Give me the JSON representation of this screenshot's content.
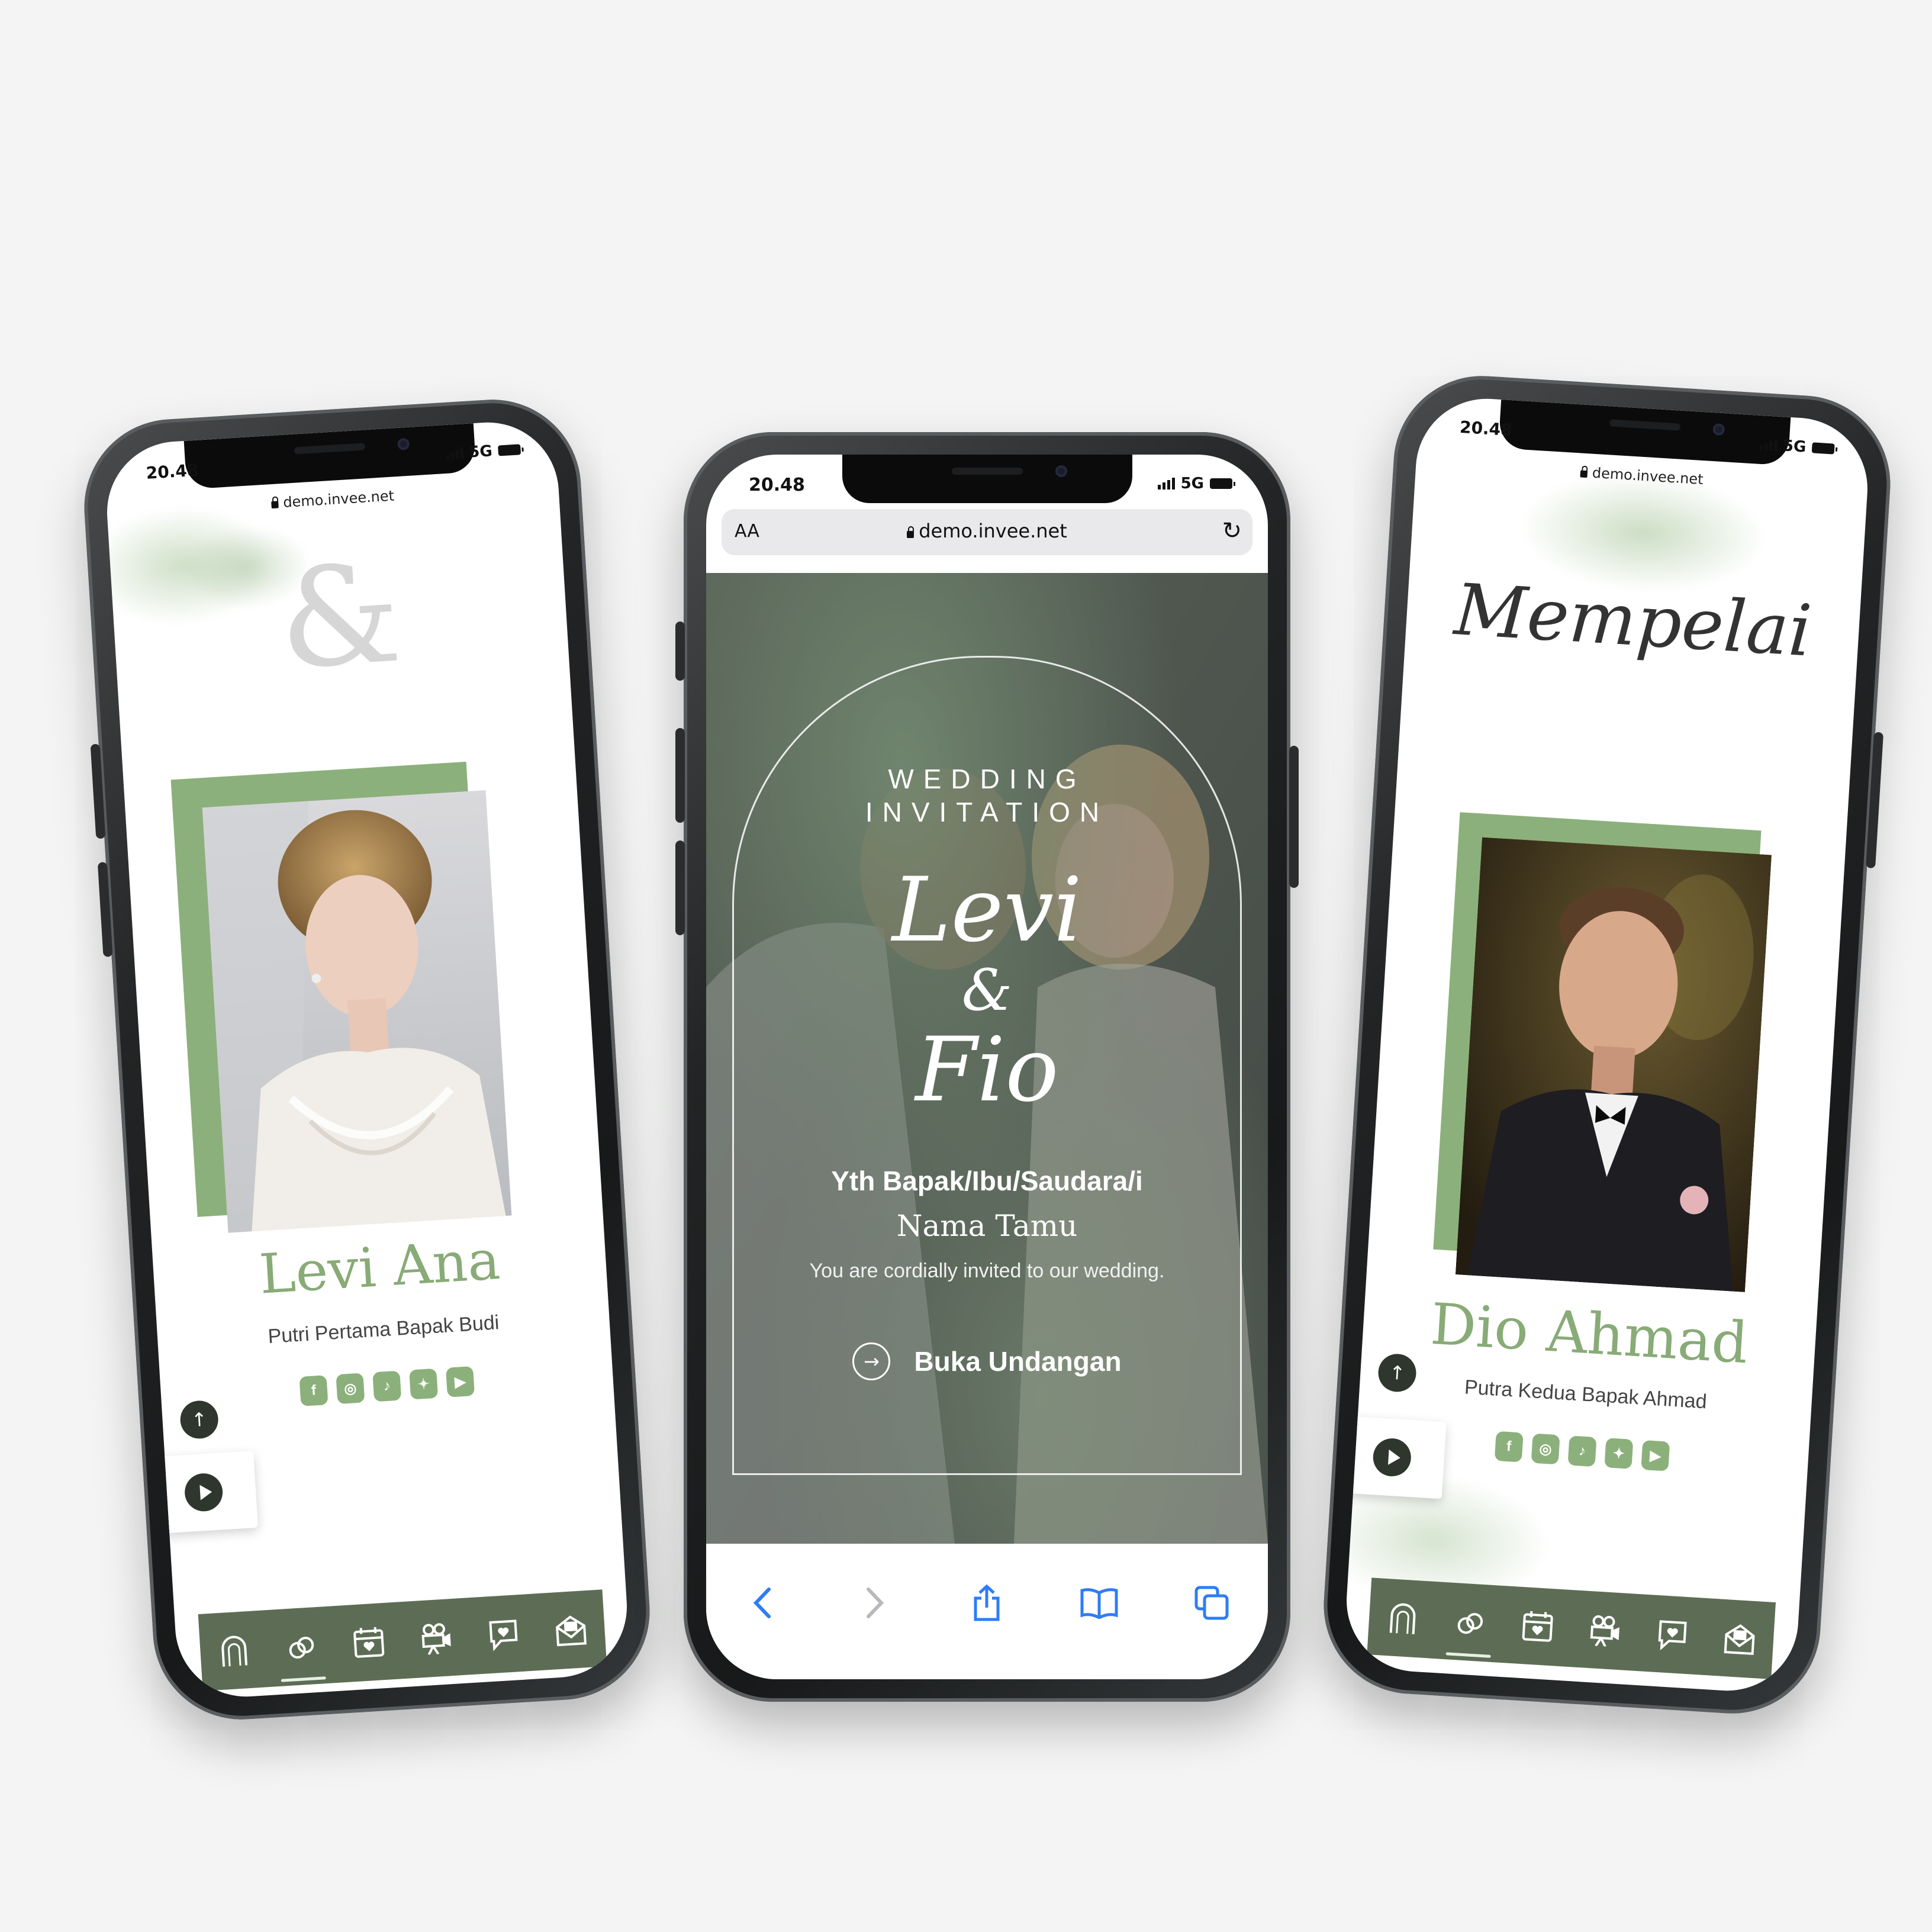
{
  "status_bar": {
    "time": "20.48",
    "network": "5G"
  },
  "browser": {
    "url": "demo.invee.net",
    "text_size": "AA"
  },
  "left_phone": {
    "ampersand": "&",
    "name": "Levi Ana",
    "subtitle": "Putri Pertama Bapak Budi",
    "socials": [
      "facebook-icon",
      "instagram-icon",
      "tiktok-icon",
      "twitter-icon",
      "youtube-icon"
    ]
  },
  "center_phone": {
    "heading_line1": "WEDDING",
    "heading_line2": "INVITATION",
    "couple_name1": "Levi",
    "couple_and": "&",
    "couple_name2": "Fio",
    "greeting": "Yth Bapak/Ibu/Saudara/i",
    "guest_name": "Nama Tamu",
    "invite_text": "You are cordially invited to our wedding.",
    "open_button": "Buka Undangan"
  },
  "right_phone": {
    "section_title": "Mempelai",
    "name": "Dio Ahmad",
    "subtitle": "Putra Kedua Bapak Ahmad",
    "socials": [
      "facebook-icon",
      "instagram-icon",
      "tiktok-icon",
      "twitter-icon",
      "youtube-icon"
    ]
  },
  "bottom_nav": [
    "arch-icon",
    "couple-rings-icon",
    "calendar-icon",
    "video-camera-icon",
    "gallery-love-icon",
    "envelope-gift-icon"
  ],
  "colors": {
    "accent_green": "#8cb07b",
    "nav_green": "#5d6d55",
    "background": "#f3f4f3"
  }
}
